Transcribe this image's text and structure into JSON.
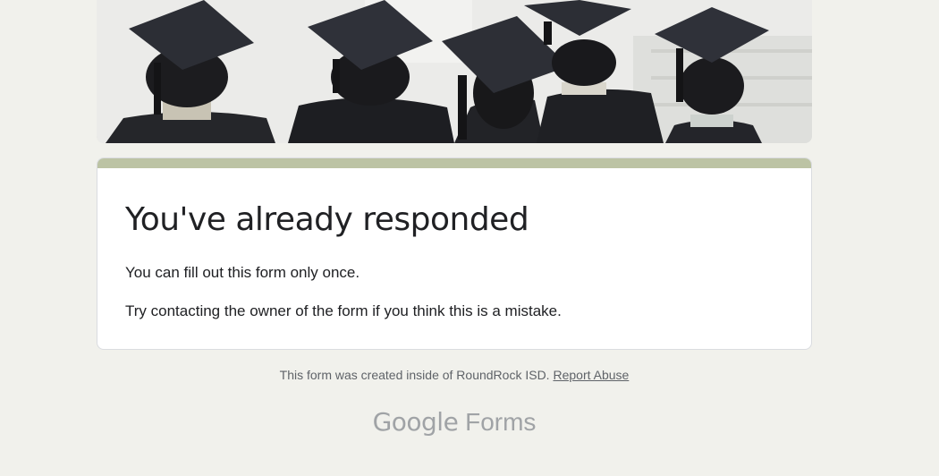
{
  "card": {
    "title": "You've already responded",
    "line1": "You can fill out this form only once.",
    "line2": "Try contacting the owner of the form if you think this is a mistake."
  },
  "footer": {
    "note": "This form was created inside of RoundRock ISD.",
    "report_label": "Report Abuse"
  },
  "brand": {
    "google": "Google",
    "forms": "Forms"
  },
  "colors": {
    "page_background": "#f1f1ec",
    "accent_bar": "#bcc3a4",
    "card_background": "#ffffff"
  }
}
